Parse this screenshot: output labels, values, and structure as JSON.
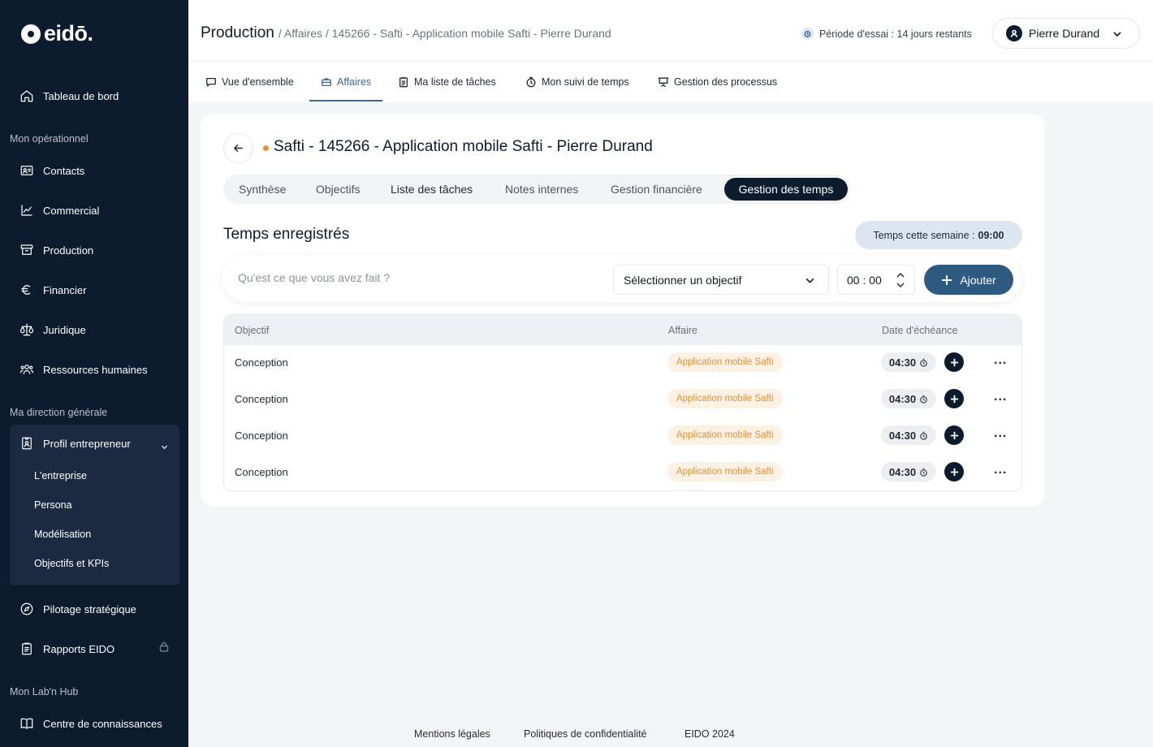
{
  "brand": {
    "name": "eidō."
  },
  "sidebar": {
    "top_item": {
      "label": "Tableau de bord",
      "icon": "home-icon"
    },
    "sections": [
      {
        "label": "Mon opérationnel"
      },
      {
        "label": "Ma direction générale"
      },
      {
        "label": "Mon Lab'n Hub"
      }
    ],
    "operationnel": [
      {
        "label": "Contacts",
        "icon": "contact-card-icon"
      },
      {
        "label": "Commercial",
        "icon": "chart-line-icon"
      },
      {
        "label": "Production",
        "icon": "archive-icon"
      },
      {
        "label": "Financier",
        "icon": "euro-icon"
      },
      {
        "label": "Juridique",
        "icon": "scale-icon"
      },
      {
        "label": "Ressources humaines",
        "icon": "team-icon"
      }
    ],
    "profil": {
      "label": "Profil entrepreneur",
      "icon": "id-badge-icon",
      "items": [
        "L'entreprise",
        "Persona",
        "Modélisation",
        "Objectifs et KPIs"
      ]
    },
    "direction_more": [
      {
        "label": "Pilotage stratégique",
        "icon": "compass-icon"
      },
      {
        "label": "Rapports EIDO",
        "icon": "clipboard-icon",
        "locked": true
      }
    ],
    "hub": [
      {
        "label": "Centre de connaissances",
        "icon": "book-icon"
      }
    ]
  },
  "header": {
    "breadcrumb_main": "Production",
    "breadcrumb_rest": "/ Affaires / 145266 - Safti - Application mobile Safti - Pierre Durand",
    "trial": "Période d'essai : 14 jours restants",
    "user_name": "Pierre Durand"
  },
  "top_tabs": [
    {
      "label": "Vue d'ensemble",
      "icon": "chat-icon"
    },
    {
      "label": "Affaires",
      "icon": "briefcase-icon",
      "active": true
    },
    {
      "label": "Ma liste de tâches",
      "icon": "clipboard-list-icon"
    },
    {
      "label": "Mon suivi de temps",
      "icon": "stopwatch-icon"
    },
    {
      "label": "Gestion des processus",
      "icon": "presentation-icon"
    }
  ],
  "card": {
    "title": "Safti - 145266 - Application mobile Safti - Pierre Durand",
    "status_color": "#e8923a",
    "subtabs": [
      "Synthèse",
      "Objectifs",
      "Liste des tâches",
      "Notes internes",
      "Gestion financière"
    ],
    "active_subtab": "Gestion des temps",
    "section_title": "Temps enregistrés",
    "week_label": "Temps cette semaine :",
    "week_value": "09:00",
    "entry": {
      "placeholder": "Qu'est ce que vous avez fait ?",
      "select_value": "Sélectionner un objectif",
      "time_value": "00 : 00",
      "add_label": "Ajouter"
    },
    "table": {
      "columns": [
        "Objectif",
        "Affaire",
        "Date d'échéance"
      ],
      "rows": [
        {
          "objectif": "Conception",
          "affaire": "Application mobile Safti",
          "time": "04:30"
        },
        {
          "objectif": "Conception",
          "affaire": "Application mobile Safti",
          "time": "04:30"
        },
        {
          "objectif": "Conception",
          "affaire": "Application mobile Safti",
          "time": "04:30"
        },
        {
          "objectif": "Conception",
          "affaire": "Application mobile Safti",
          "time": "04:30"
        }
      ]
    }
  },
  "footer": {
    "links": [
      "Mentions légales",
      "Politiques de confidentialité",
      "EIDO 2024"
    ]
  },
  "colors": {
    "sidebar_bg": "#0d1b2e",
    "accent": "#3d6797",
    "add_button": "#2e5a82",
    "tag_text": "#e09232",
    "tag_bg": "#fdf1e4"
  }
}
